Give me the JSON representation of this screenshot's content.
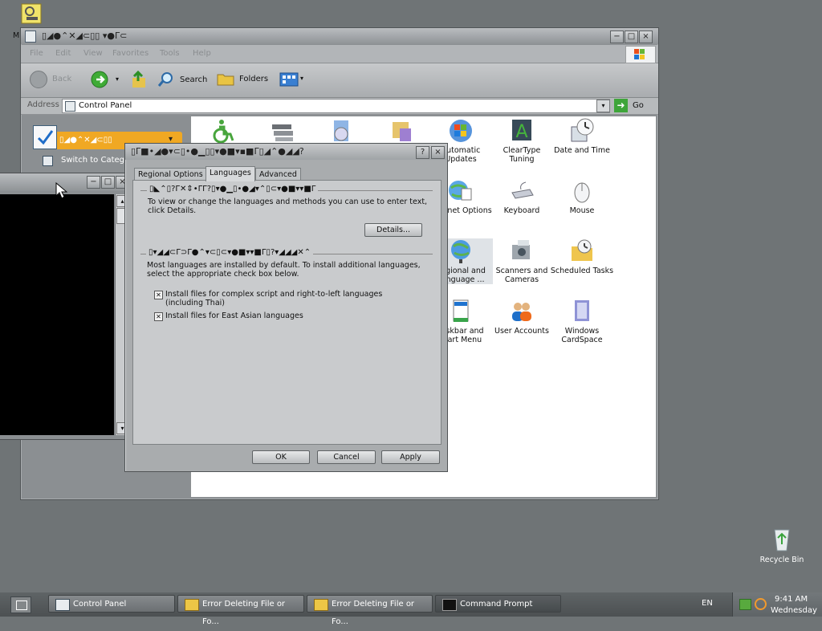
{
  "desktop": {
    "top_icon_label": "M",
    "recycle_bin_label": "Recycle Bin"
  },
  "control_panel": {
    "title": "▯◢●⌃✕◢⊂▯▯ ▾●Γ⊂",
    "menu": [
      "File",
      "Edit",
      "View",
      "Favorites",
      "Tools",
      "Help"
    ],
    "toolbar": {
      "back": "Back",
      "search": "Search",
      "folders": "Folders"
    },
    "address_label": "Address",
    "address_value": "Control Panel",
    "go_label": "Go",
    "sidebar_title": "▯◢●⌃✕◢⊂▯▯",
    "switch_label": "Switch to Categ",
    "items": [
      {
        "label": "",
        "icon": "accessibility-icon"
      },
      {
        "label": "",
        "icon": "add-hardware-icon"
      },
      {
        "label": "",
        "icon": "add-remove-programs-icon"
      },
      {
        "label": "",
        "icon": "administrative-tools-icon"
      },
      {
        "label": "Automatic Updates",
        "icon": "windows-flag-icon"
      },
      {
        "label": "ClearType Tuning",
        "icon": "cleartype-icon"
      },
      {
        "label": "Date and Time",
        "icon": "clock-icon"
      },
      {
        "label": "Internet Options",
        "icon": "globe-icon"
      },
      {
        "label": "Keyboard",
        "icon": "keyboard-icon"
      },
      {
        "label": "Mouse",
        "icon": "mouse-icon"
      },
      {
        "label": "Regional and Language ...",
        "icon": "globe-icon"
      },
      {
        "label": "Scanners and Cameras",
        "icon": "scanner-icon"
      },
      {
        "label": "Scheduled Tasks",
        "icon": "folder-clock-icon"
      },
      {
        "label": "Taskbar and Start Menu",
        "icon": "taskbar-icon"
      },
      {
        "label": "User Accounts",
        "icon": "users-icon"
      },
      {
        "label": "Windows CardSpace",
        "icon": "cardspace-icon"
      }
    ]
  },
  "dialog": {
    "title": "▯Γ■•◢●▾⊂▯•●▁▯▯▾●■▾▪■Γ▯◢⌃●◢◢?",
    "tabs": [
      "Regional Options",
      "Languages",
      "Advanced"
    ],
    "group1_title": "▯◣⌃▯?Γ✕⇕•ΓΓ?▯▾●▁▯•●◢▾⌃▯⊂▾●■▾▾■Γ",
    "group1_text": "To view or change the languages and methods you can use to enter text, click Details.",
    "details_button": "Details...",
    "group2_title": "▯▾◢◢⊂Γ⊃Γ●⌃▾⊂▯⊂▾●■▾▾■Γ▯?▾◢◢◢✕⌃",
    "group2_text": "Most languages are installed by default. To install additional languages, select the appropriate check box below.",
    "checkbox1": "Install files for complex script and right-to-left languages (including Thai)",
    "checkbox2": "Install files for East Asian languages",
    "ok": "OK",
    "cancel": "Cancel",
    "apply": "Apply"
  },
  "taskbar": {
    "buttons": [
      "Control Panel",
      "Error Deleting File or Fo...",
      "Error Deleting File or Fo...",
      "Command Prompt"
    ],
    "language": "EN",
    "time": "9:41 AM",
    "day": "Wednesday"
  }
}
